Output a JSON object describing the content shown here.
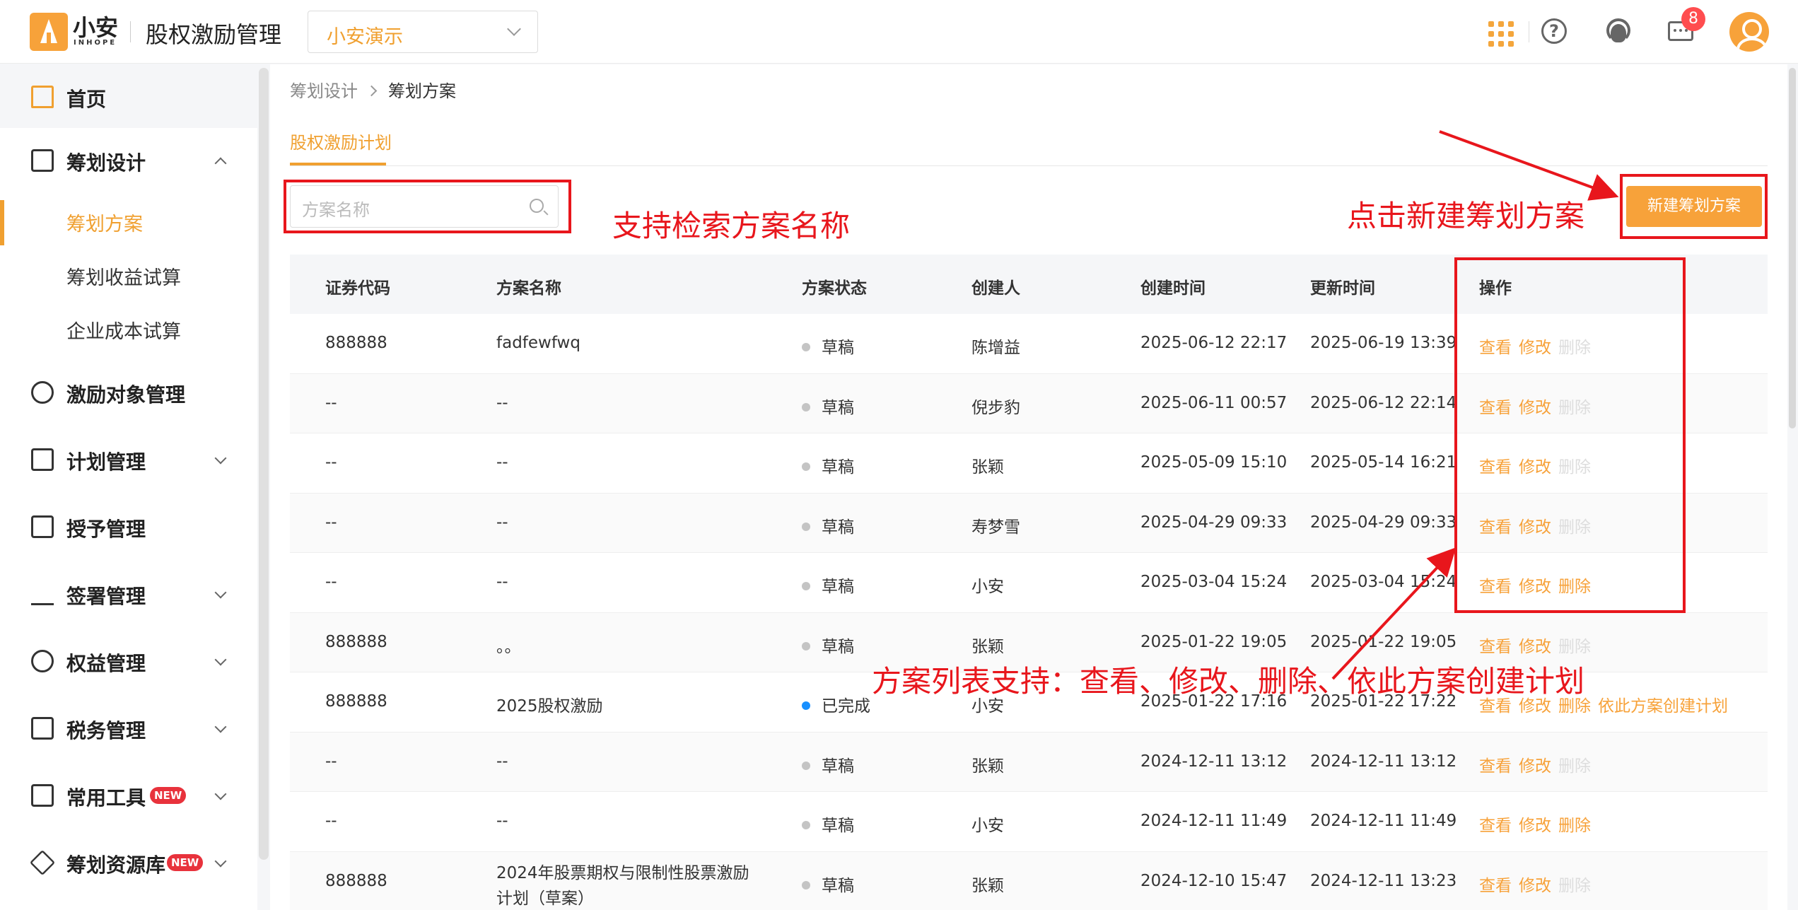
{
  "header": {
    "brand": "小安",
    "brand_en": "INHOPE",
    "system_title": "股权激励管理",
    "company": "小安演示",
    "message_count": "8"
  },
  "sidebar": {
    "home": "首页",
    "planning_design": "筹划设计",
    "sub_items": [
      "筹划方案",
      "筹划收益试算",
      "企业成本试算"
    ],
    "items": [
      "激励对象管理",
      "计划管理",
      "授予管理",
      "签署管理",
      "权益管理",
      "税务管理",
      "常用工具",
      "筹划资源库"
    ],
    "new_tag": "NEW"
  },
  "breadcrumb": [
    "筹划设计",
    "筹划方案"
  ],
  "tab": "股权激励计划",
  "search": {
    "placeholder": "方案名称"
  },
  "new_button": "新建筹划方案",
  "table": {
    "headers": [
      "证券代码",
      "方案名称",
      "方案状态",
      "创建人",
      "创建时间",
      "更新时间",
      "操作"
    ],
    "rows": [
      {
        "code": "888888",
        "name": "fadfewfwq",
        "status": "草稿",
        "creator": "陈增益",
        "created": "2025-06-12 22:17",
        "updated": "2025-06-19 13:39",
        "actions": [
          "查看",
          "修改",
          "删除"
        ]
      },
      {
        "code": "--",
        "name": "--",
        "status": "草稿",
        "creator": "倪步豹",
        "created": "2025-06-11 00:57",
        "updated": "2025-06-12 22:14",
        "actions": [
          "查看",
          "修改",
          "删除"
        ]
      },
      {
        "code": "--",
        "name": "--",
        "status": "草稿",
        "creator": "张颖",
        "created": "2025-05-09 15:10",
        "updated": "2025-05-14 16:21",
        "actions": [
          "查看",
          "修改",
          "删除"
        ]
      },
      {
        "code": "--",
        "name": "--",
        "status": "草稿",
        "creator": "寿梦雪",
        "created": "2025-04-29 09:33",
        "updated": "2025-04-29 09:33",
        "actions": [
          "查看",
          "修改",
          "删除"
        ]
      },
      {
        "code": "--",
        "name": "--",
        "status": "草稿",
        "creator": "小安",
        "created": "2025-03-04 15:24",
        "updated": "2025-03-04 15:24",
        "actions": [
          "查看",
          "修改",
          "删除"
        ]
      },
      {
        "code": "888888",
        "name": "。。",
        "status": "草稿",
        "creator": "张颖",
        "created": "2025-01-22 19:05",
        "updated": "2025-01-22 19:05",
        "actions": [
          "查看",
          "修改",
          "删除"
        ]
      },
      {
        "code": "888888",
        "name": "2025股权激励",
        "status": "已完成",
        "creator": "小安",
        "created": "2025-01-22 17:16",
        "updated": "2025-01-22 17:22",
        "actions": [
          "查看",
          "修改",
          "删除",
          "依此方案创建计划"
        ]
      },
      {
        "code": "--",
        "name": "--",
        "status": "草稿",
        "creator": "张颖",
        "created": "2024-12-11 13:12",
        "updated": "2024-12-11 13:12",
        "actions": [
          "查看",
          "修改",
          "删除"
        ]
      },
      {
        "code": "--",
        "name": "--",
        "status": "草稿",
        "creator": "小安",
        "created": "2024-12-11 11:49",
        "updated": "2024-12-11 11:49",
        "actions": [
          "查看",
          "修改",
          "删除"
        ]
      },
      {
        "code": "888888",
        "name": "2024年股票期权与限制性股票激励计划（草案）",
        "status": "草稿",
        "creator": "张颖",
        "created": "2024-12-10 15:47",
        "updated": "2024-12-11 13:23",
        "actions": [
          "查看",
          "修改",
          "删除"
        ]
      }
    ]
  },
  "annotations": {
    "search_note": "支持检索方案名称",
    "new_note": "点击新建筹划方案",
    "list_note": "方案列表支持：查看、修改、删除、依此方案创建计划",
    "color": "#e8161c"
  },
  "colors": {
    "accent": "#f7a23a",
    "done": "#1890ff"
  }
}
